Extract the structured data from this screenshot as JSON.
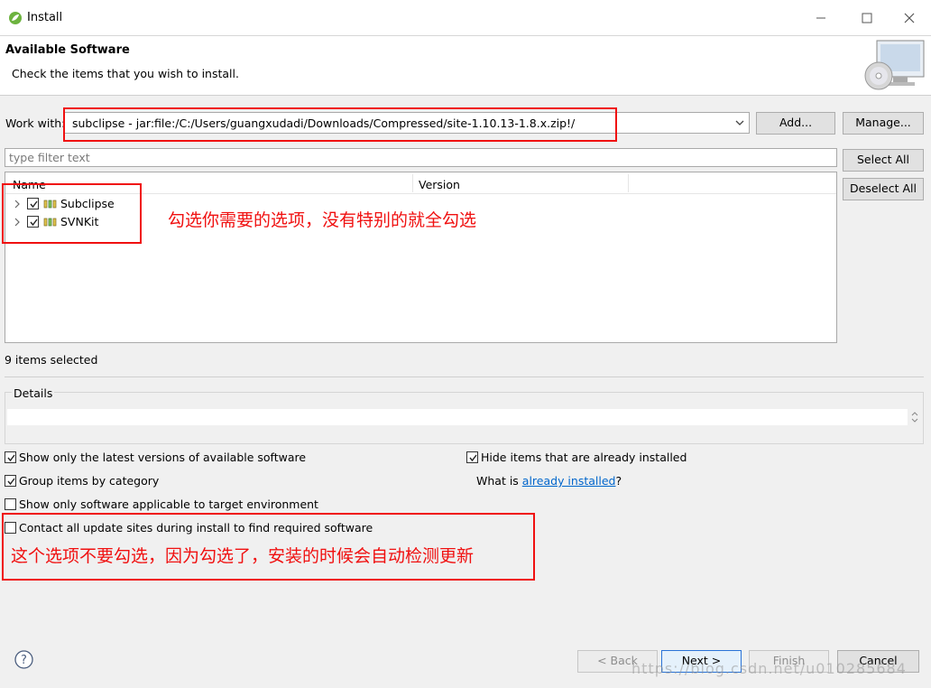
{
  "window": {
    "title": "Install",
    "icon": "eclipse-leaf-icon"
  },
  "banner": {
    "heading": "Available Software",
    "subtitle": "Check the items that you wish to install."
  },
  "work_with": {
    "label": "Work with:",
    "value": "subclipse - jar:file:/C:/Users/guangxudadi/Downloads/Compressed/site-1.10.13-1.8.x.zip!/",
    "add_label": "Add...",
    "manage_label": "Manage..."
  },
  "filter": {
    "placeholder": "type filter text"
  },
  "side_buttons": {
    "select_all": "Select All",
    "deselect_all": "Deselect All"
  },
  "tree": {
    "columns": [
      "Name",
      "Version"
    ],
    "items": [
      {
        "label": "Subclipse",
        "checked": true
      },
      {
        "label": "SVNKit",
        "checked": true
      }
    ]
  },
  "status": {
    "items_selected": "9 items selected"
  },
  "details": {
    "label": "Details"
  },
  "options": {
    "latest_versions": "Show only the latest versions of available software",
    "hide_installed": "Hide items that are already installed",
    "group_by_category": "Group items by category",
    "what_is_prefix": "What is ",
    "what_is_link": "already installed",
    "what_is_suffix": "?",
    "target_env": "Show only software applicable to target environment",
    "contact_sites": "Contact all update sites during install to find required software"
  },
  "annotations": {
    "tree_note": "勾选你需要的选项，没有特别的就全勾选",
    "contact_note": "这个选项不要勾选，因为勾选了，安装的时候会自动检测更新",
    "color": "#f01010"
  },
  "footer": {
    "back": "< Back",
    "next": "Next >",
    "finish": "Finish",
    "cancel": "Cancel",
    "watermark": "https://blog.csdn.net/u010285684"
  }
}
